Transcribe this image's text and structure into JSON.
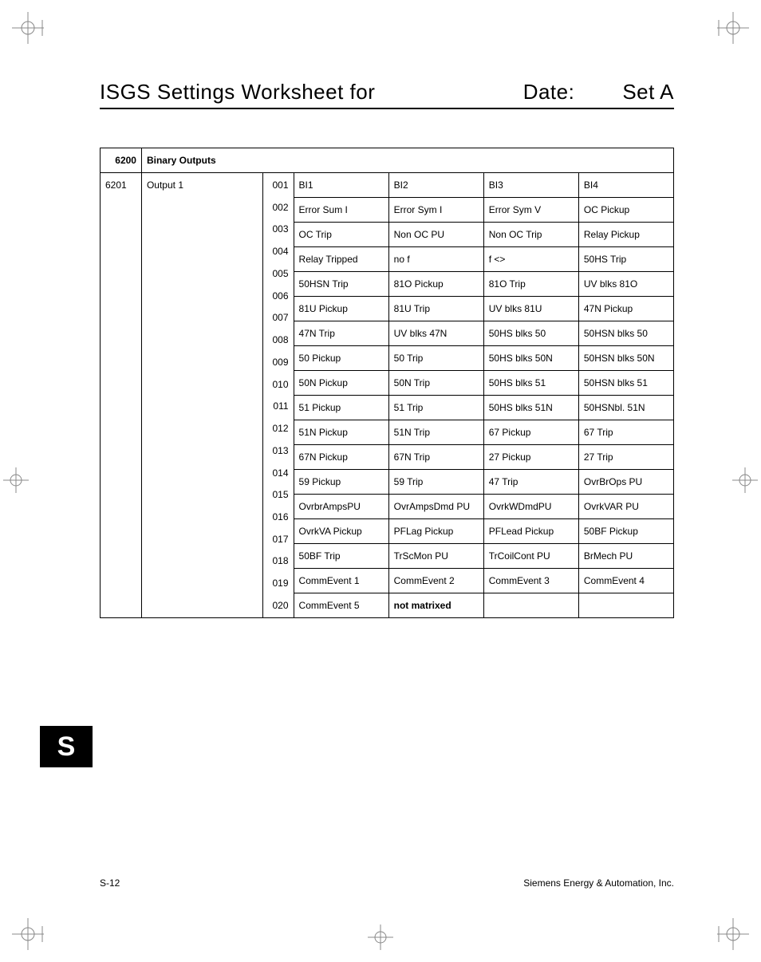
{
  "header": {
    "title": "ISGS Settings Worksheet for",
    "date_label": "Date:",
    "set_label": "Set A"
  },
  "group": {
    "code": "6200",
    "name": "Binary Outputs"
  },
  "block": {
    "addr": "6201",
    "name": "Output 1"
  },
  "rows": [
    {
      "sub": "001",
      "c1": "BI1",
      "c2": "BI2",
      "c3": "BI3",
      "c4": "BI4"
    },
    {
      "sub": "002",
      "c1": "Error Sum I",
      "c2": "Error Sym I",
      "c3": "Error Sym V",
      "c4": "OC Pickup"
    },
    {
      "sub": "003",
      "c1": "OC Trip",
      "c2": "Non OC PU",
      "c3": "Non OC Trip",
      "c4": "Relay Pickup"
    },
    {
      "sub": "004",
      "c1": "Relay Tripped",
      "c2": "no f",
      "c3": "f <>",
      "c4": "50HS Trip"
    },
    {
      "sub": "005",
      "c1": "50HSN Trip",
      "c2": "81O Pickup",
      "c3": "81O Trip",
      "c4": "UV blks 81O"
    },
    {
      "sub": "006",
      "c1": "81U Pickup",
      "c2": "81U Trip",
      "c3": "UV blks 81U",
      "c4": "47N Pickup"
    },
    {
      "sub": "007",
      "c1": "47N Trip",
      "c2": "UV blks 47N",
      "c3": "50HS blks 50",
      "c4": "50HSN blks 50"
    },
    {
      "sub": "008",
      "c1": "50 Pickup",
      "c2": "50 Trip",
      "c3": "50HS blks 50N",
      "c4": "50HSN blks 50N"
    },
    {
      "sub": "009",
      "c1": "50N Pickup",
      "c2": "50N Trip",
      "c3": "50HS blks 51",
      "c4": "50HSN blks 51"
    },
    {
      "sub": "010",
      "c1": "51 Pickup",
      "c2": "51 Trip",
      "c3": "50HS blks 51N",
      "c4": "50HSNbl. 51N"
    },
    {
      "sub": "011",
      "c1": "51N Pickup",
      "c2": "51N Trip",
      "c3": "67 Pickup",
      "c4": "67 Trip"
    },
    {
      "sub": "012",
      "c1": "67N Pickup",
      "c2": "67N Trip",
      "c3": "27 Pickup",
      "c4": "27 Trip"
    },
    {
      "sub": "013",
      "c1": "59 Pickup",
      "c2": "59 Trip",
      "c3": "47 Trip",
      "c4": "OvrBrOps PU"
    },
    {
      "sub": "014",
      "c1": "OvrbrAmpsPU",
      "c2": "OvrAmpsDmd PU",
      "c3": "OvrkWDmdPU",
      "c4": "OvrkVAR PU"
    },
    {
      "sub": "015",
      "c1": "OvrkVA Pickup",
      "c2": "PFLag Pickup",
      "c3": "PFLead Pickup",
      "c4": "50BF Pickup"
    },
    {
      "sub": "016",
      "c1": "50BF Trip",
      "c2": "TrScMon PU",
      "c3": "TrCoilCont PU",
      "c4": "BrMech PU"
    },
    {
      "sub": "017",
      "c1": "CommEvent 1",
      "c2": "CommEvent 2",
      "c3": "CommEvent 3",
      "c4": "CommEvent 4"
    },
    {
      "sub": "018",
      "c1": "CommEvent 5",
      "c2": "not matrixed",
      "c3": "",
      "c4": "",
      "bold_c2": true
    },
    {
      "sub": "019"
    },
    {
      "sub": "020"
    }
  ],
  "side_tab": "S",
  "footer": {
    "left": "S-12",
    "right": "Siemens Energy & Automation, Inc."
  }
}
